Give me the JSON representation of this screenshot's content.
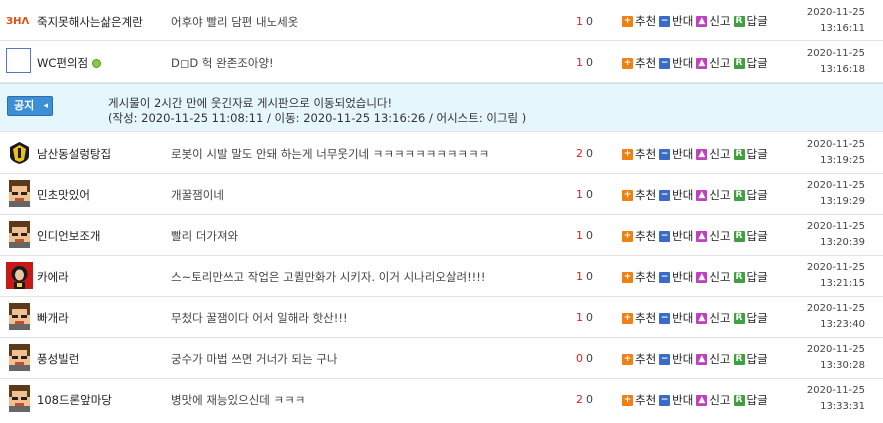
{
  "actions": {
    "recommend": "추천",
    "oppose": "반대",
    "report": "신고",
    "reply": "답글"
  },
  "notice": {
    "badge": "공지",
    "line1": "게시물이 2시간 만에 웃긴자료 게시판으로 이동되었습니다!",
    "line2": "(작성: 2020-11-25 11:08:11 / 이동: 2020-11-25 13:16:26 / 어시스트: 이그림 )"
  },
  "comments": [
    {
      "nick": "죽지못해사는삶은계란",
      "text": "어후야 빨리 담편 내노세옷",
      "up": "1",
      "down": "0",
      "date": "2020-11-25",
      "time": "13:16:11",
      "avatar": "logo-avatar"
    },
    {
      "nick": "WC편의점",
      "text": "D◻D 헉 완존조아양!",
      "up": "1",
      "down": "0",
      "date": "2020-11-25",
      "time": "13:16:18",
      "avatar": "blank-avatar"
    },
    {
      "nick": "남산동설렁탕집",
      "text": "로봇이 시발 말도 안돼 하는게 너무웃기네 ㅋㅋㅋㅋㅋㅋㅋㅋㅋㅋㅋ",
      "up": "2",
      "down": "0",
      "date": "2020-11-25",
      "time": "13:19:25",
      "avatar": "badge-avatar"
    },
    {
      "nick": "민초맛있어",
      "text": "개꿀잼이네",
      "up": "1",
      "down": "0",
      "date": "2020-11-25",
      "time": "13:19:29",
      "avatar": "pixel-avatar"
    },
    {
      "nick": "인디언보조개",
      "text": "빨리 더가져와",
      "up": "1",
      "down": "0",
      "date": "2020-11-25",
      "time": "13:20:39",
      "avatar": "pixel-avatar"
    },
    {
      "nick": "카에라",
      "text": "스~토리만쓰고 작업은 고퀼만화가 시키자. 이거 시나리오살려!!!!",
      "up": "1",
      "down": "0",
      "date": "2020-11-25",
      "time": "13:21:15",
      "avatar": "photo-avatar"
    },
    {
      "nick": "빠개라",
      "text": "무첬다 꿀잼이다 어서 일해라 핫산!!!",
      "up": "1",
      "down": "0",
      "date": "2020-11-25",
      "time": "13:23:40",
      "avatar": "pixel-avatar"
    },
    {
      "nick": "풍성빌런",
      "text": "궁수가 마법 쓰면 거너가 되는 구나",
      "up": "0",
      "down": "0",
      "date": "2020-11-25",
      "time": "13:30:28",
      "avatar": "pixel-avatar"
    },
    {
      "nick": "108드론앞마당",
      "text": "병맛에 재능있으신데 ㅋㅋㅋ",
      "up": "2",
      "down": "0",
      "date": "2020-11-25",
      "time": "13:33:31",
      "avatar": "pixel-avatar"
    }
  ]
}
